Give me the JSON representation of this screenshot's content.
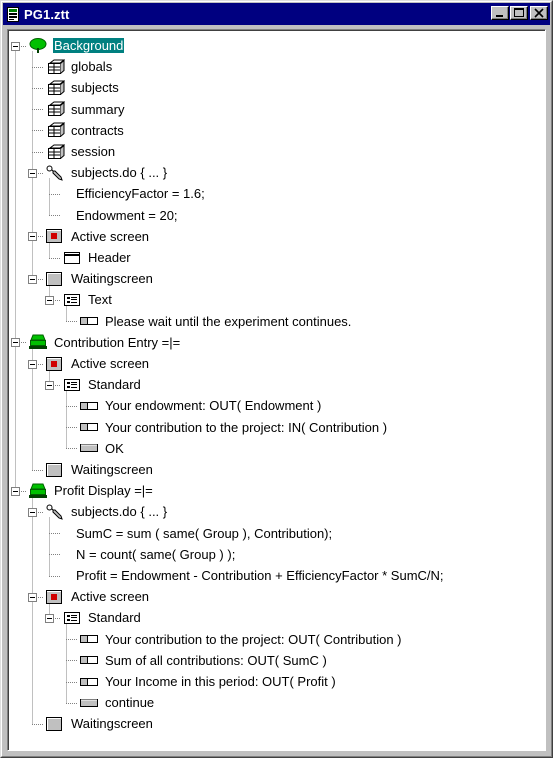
{
  "window": {
    "title": "PG1.ztt"
  },
  "tree": [
    {
      "label": "Background",
      "depth": 0,
      "icon": "globe-tree-icon",
      "expander": "-",
      "selected": true
    },
    {
      "label": "globals",
      "depth": 1,
      "icon": "table-icon"
    },
    {
      "label": "subjects",
      "depth": 1,
      "icon": "table-icon"
    },
    {
      "label": "summary",
      "depth": 1,
      "icon": "table-icon"
    },
    {
      "label": "contracts",
      "depth": 1,
      "icon": "table-icon"
    },
    {
      "label": "session",
      "depth": 1,
      "icon": "table-icon"
    },
    {
      "label": "subjects.do { ... }",
      "depth": 1,
      "icon": "wrench-icon",
      "expander": "-"
    },
    {
      "label": "EfficiencyFactor = 1.6;",
      "depth": 2,
      "icon": null
    },
    {
      "label": "Endowment = 20;",
      "depth": 2,
      "icon": null
    },
    {
      "label": "Active screen",
      "depth": 1,
      "icon": "active-screen-icon",
      "expander": "-"
    },
    {
      "label": "Header",
      "depth": 2,
      "icon": "header-box-icon"
    },
    {
      "label": "Waitingscreen",
      "depth": 1,
      "icon": "waiting-screen-icon",
      "expander": "-"
    },
    {
      "label": "Text",
      "depth": 2,
      "icon": "standard-box-icon",
      "expander": "-"
    },
    {
      "label": "Please wait until the experiment continues.",
      "depth": 3,
      "icon": "item-icon"
    },
    {
      "label": "Contribution Entry =|=",
      "depth": 0,
      "icon": "stage-icon",
      "expander": "-"
    },
    {
      "label": "Active screen",
      "depth": 1,
      "icon": "active-screen-icon",
      "expander": "-"
    },
    {
      "label": "Standard",
      "depth": 2,
      "icon": "standard-box-icon",
      "expander": "-"
    },
    {
      "label": "Your endowment: OUT( Endowment )",
      "depth": 3,
      "icon": "item-icon"
    },
    {
      "label": "Your contribution to the project: IN( Contribution )",
      "depth": 3,
      "icon": "item-icon"
    },
    {
      "label": "OK",
      "depth": 3,
      "icon": "button-icon"
    },
    {
      "label": "Waitingscreen",
      "depth": 1,
      "icon": "waiting-screen-icon"
    },
    {
      "label": "Profit Display =|=",
      "depth": 0,
      "icon": "stage-icon",
      "expander": "-"
    },
    {
      "label": "subjects.do { ... }",
      "depth": 1,
      "icon": "wrench-icon",
      "expander": "-"
    },
    {
      "label": "SumC = sum ( same( Group ), Contribution);",
      "depth": 2,
      "icon": null
    },
    {
      "label": "N = count(  same( Group ) );",
      "depth": 2,
      "icon": null
    },
    {
      "label": "Profit = Endowment - Contribution + EfficiencyFactor * SumC/N;",
      "depth": 2,
      "icon": null
    },
    {
      "label": "Active screen",
      "depth": 1,
      "icon": "active-screen-icon",
      "expander": "-"
    },
    {
      "label": "Standard",
      "depth": 2,
      "icon": "standard-box-icon",
      "expander": "-"
    },
    {
      "label": "Your contribution to the project: OUT( Contribution )",
      "depth": 3,
      "icon": "item-icon"
    },
    {
      "label": "Sum of all contributions: OUT( SumC )",
      "depth": 3,
      "icon": "item-icon"
    },
    {
      "label": "Your Income in this period: OUT( Profit )",
      "depth": 3,
      "icon": "item-icon"
    },
    {
      "label": "continue",
      "depth": 3,
      "icon": "button-icon"
    },
    {
      "label": "Waitingscreen",
      "depth": 1,
      "icon": "waiting-screen-icon"
    }
  ]
}
